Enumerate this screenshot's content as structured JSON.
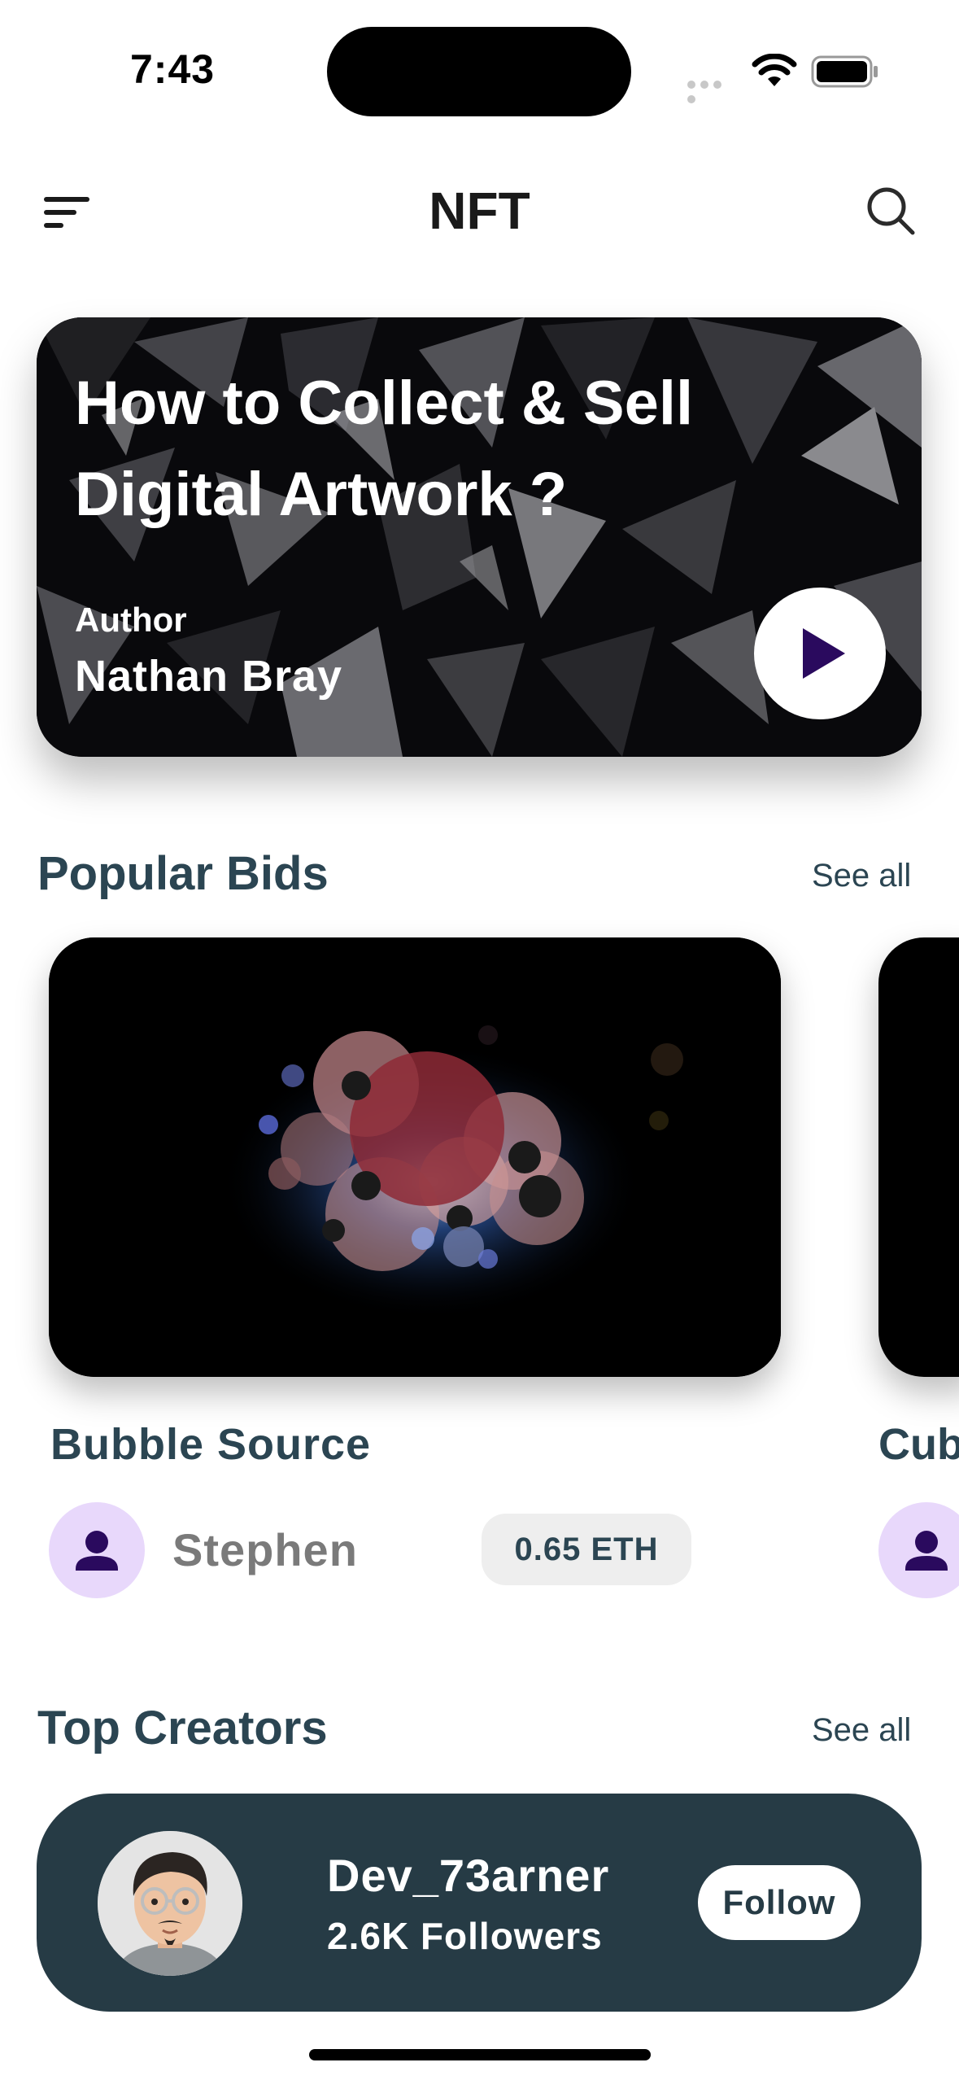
{
  "status_bar": {
    "time": "7:43"
  },
  "header": {
    "title": "NFT",
    "menu_icon": "menu-lines-icon",
    "search_icon": "search-icon"
  },
  "hero": {
    "title": "How to Collect & Sell Digital Artwork ?",
    "author_label": "Author",
    "author_name": "Nathan Bray"
  },
  "popular_bids": {
    "title": "Popular Bids",
    "see_all": "See all",
    "items": [
      {
        "name": "Bubble Source",
        "owner": "Stephen",
        "price": "0.65 ETH"
      },
      {
        "name": "Cub"
      }
    ]
  },
  "top_creators": {
    "title": "Top Creators",
    "see_all": "See all",
    "items": [
      {
        "name": "Dev_73arner",
        "followers": "2.6K Followers",
        "follow_label": "Follow"
      }
    ]
  },
  "colors": {
    "accent_dark": "#263b45",
    "play_purple": "#2a0a5e",
    "avatar_bg": "#e8d8fb"
  }
}
